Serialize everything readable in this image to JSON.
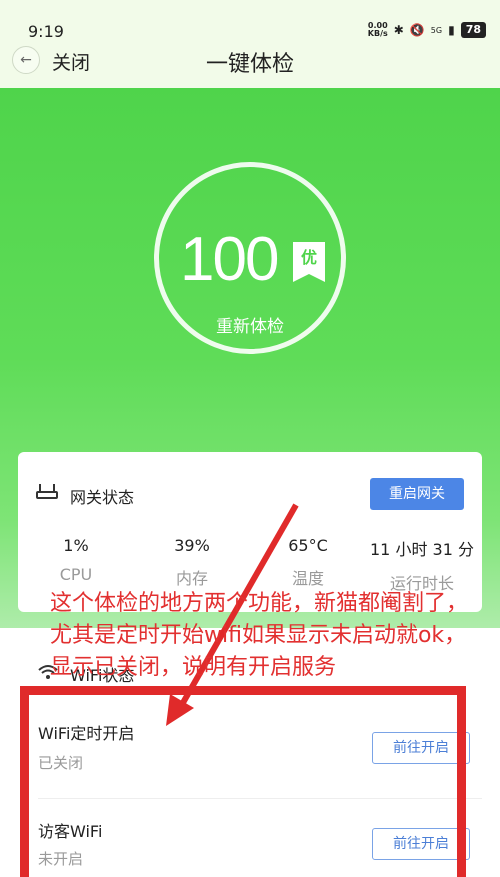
{
  "status_bar": {
    "time": "9:19",
    "net_speed_value": "0.00",
    "net_speed_unit": "KB/s",
    "signal": "5G",
    "battery": "78"
  },
  "header": {
    "back_icon": "back-arrow-icon",
    "close_label": "关闭",
    "title": "一键体检"
  },
  "hero": {
    "score": "100",
    "grade": "优",
    "recheck_label": "重新体检"
  },
  "gateway": {
    "title": "网关状态",
    "restart_button": "重启网关",
    "stats": [
      {
        "value": "1%",
        "label": "CPU"
      },
      {
        "value": "39%",
        "label": "内存"
      },
      {
        "value": "65°C",
        "label": "温度"
      },
      {
        "value": "11 小时 31 分",
        "label": "运行时长"
      }
    ]
  },
  "wifi": {
    "title": "WiFi状态",
    "rows": [
      {
        "title": "WiFi定时开启",
        "status": "已关闭",
        "button": "前往开启"
      },
      {
        "title": "访客WiFi",
        "status": "未开启",
        "button": "前往开启"
      }
    ]
  },
  "annotation": {
    "text": "这个体检的地方两个功能，新猫都阉割了，尤其是定时开始wifi如果显示未启动就ok，显示已关闭，说明有开启服务",
    "color": "#e23030"
  },
  "colors": {
    "accent_green": "#4fd44b",
    "button_blue": "#4c86e6",
    "annotation_red": "#e02a2a"
  }
}
